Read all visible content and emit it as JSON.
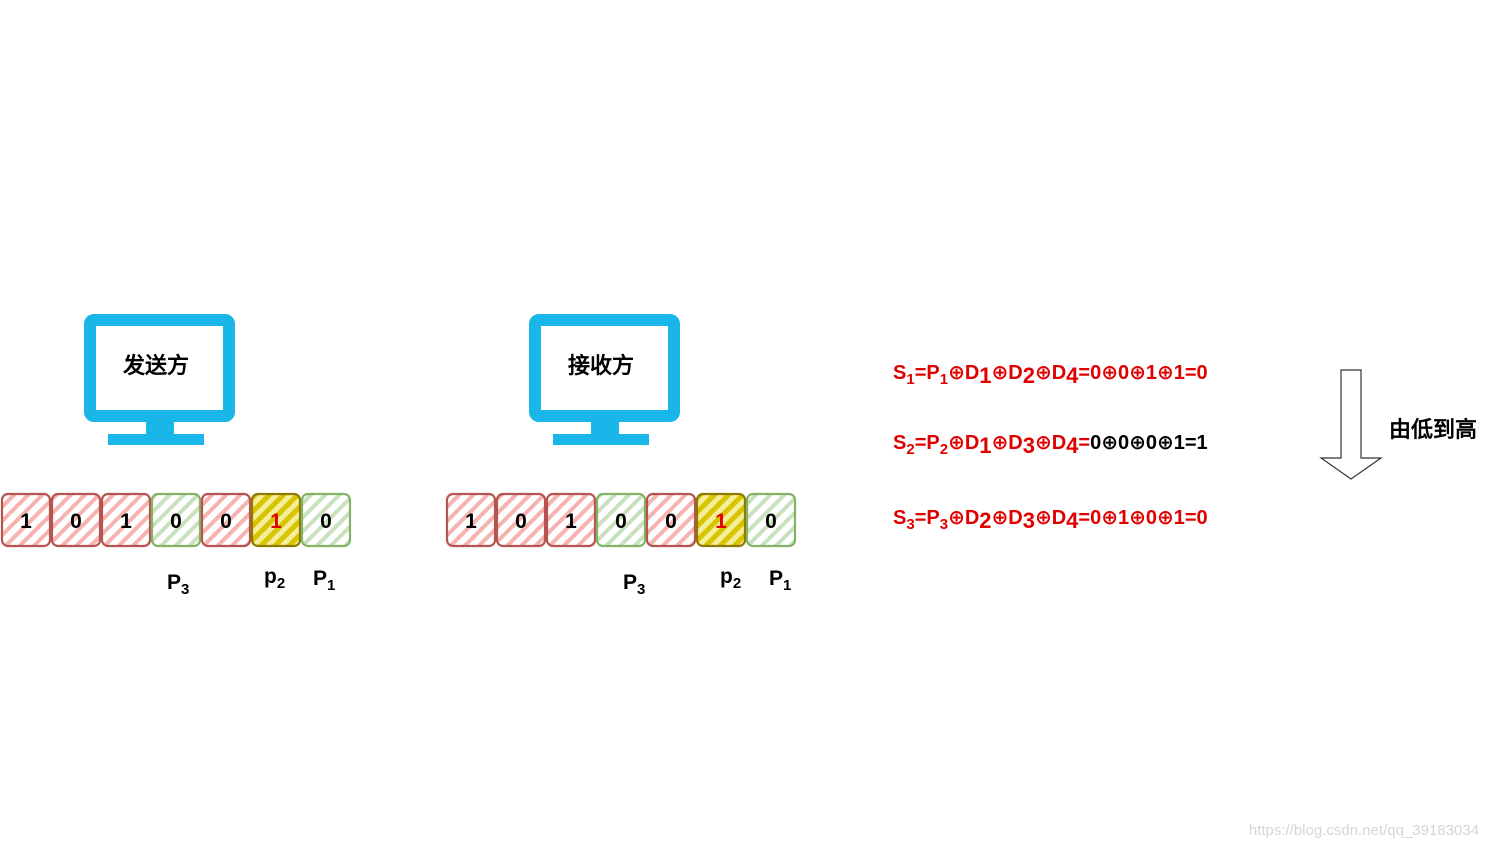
{
  "sender": {
    "label": "发送方",
    "bits": [
      {
        "value": "1",
        "kind": "data"
      },
      {
        "value": "0",
        "kind": "data"
      },
      {
        "value": "1",
        "kind": "data"
      },
      {
        "value": "0",
        "kind": "parity"
      },
      {
        "value": "0",
        "kind": "data"
      },
      {
        "value": "1",
        "kind": "parity-highlight"
      },
      {
        "value": "0",
        "kind": "parity"
      }
    ],
    "parity_labels": {
      "p3": "P",
      "p3_sub": "3",
      "p2": "p",
      "p2_sub": "2",
      "p1": "P",
      "p1_sub": "1"
    }
  },
  "receiver": {
    "label": "接收方",
    "bits": [
      {
        "value": "1",
        "kind": "data"
      },
      {
        "value": "0",
        "kind": "data"
      },
      {
        "value": "1",
        "kind": "data"
      },
      {
        "value": "0",
        "kind": "parity"
      },
      {
        "value": "0",
        "kind": "data"
      },
      {
        "value": "1",
        "kind": "parity-highlight"
      },
      {
        "value": "0",
        "kind": "parity"
      }
    ],
    "parity_labels": {
      "p3": "P",
      "p3_sub": "3",
      "p2": "p",
      "p2_sub": "2",
      "p1": "P",
      "p1_sub": "1"
    }
  },
  "formulas": {
    "s1": {
      "s": "S",
      "s_sub": "1",
      "eq1": "=P",
      "p_sub": "1",
      "x1": "⊕D",
      "d1": "1",
      "x2": "⊕D",
      "d2": "2",
      "x3": "⊕D",
      "d3": "4",
      "tail": "=0⊕0⊕1⊕1=0"
    },
    "s2": {
      "s": "S",
      "s_sub": "2",
      "eq1": "=P",
      "p_sub": "2",
      "x1": "⊕D",
      "d1": "1",
      "x2": "⊕D",
      "d2": "3",
      "x3": "⊕D",
      "d3": "4",
      "tail_red": "=",
      "tail_black": "0⊕0⊕0⊕1=1"
    },
    "s3": {
      "s": "S",
      "s_sub": "3",
      "eq1": "=P",
      "p_sub": "3",
      "x1": "⊕D",
      "d1": "2",
      "x2": "⊕D",
      "d2": "3",
      "x3": "⊕D",
      "d3": "4",
      "tail": "=0⊕1⊕0⊕1=0"
    }
  },
  "order_label": "由低到高",
  "watermark": "https://blog.csdn.net/qq_39183034",
  "colors": {
    "monitor": "#1ab6ea",
    "data_stroke": "#b85450",
    "data_hatch": "#f5b3b1",
    "parity_stroke": "#82b366",
    "parity_hatch": "#c9e2bd",
    "highlight_stroke": "#8c7a00",
    "highlight_hatch": "#d8c400",
    "highlight_digit": "#e00000",
    "formula_red": "#e00000"
  }
}
